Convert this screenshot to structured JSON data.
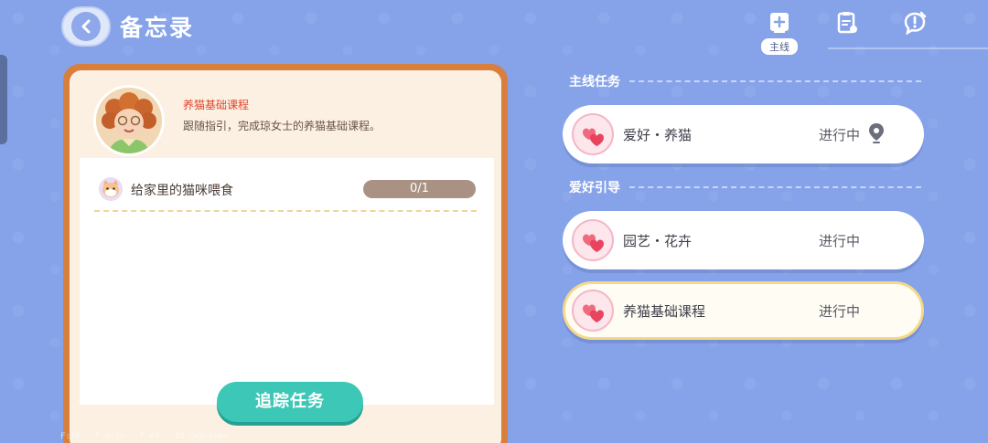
{
  "header": {
    "title": "备忘录",
    "mainline_tag": "主线"
  },
  "course": {
    "title": "养猫基础课程",
    "description": "跟随指引，完成琼女士的养猫基础课程。"
  },
  "task": {
    "label": "给家里的猫咪喂食",
    "progress": "0/1"
  },
  "track_button": "追踪任务",
  "debug_text": "F:58   T:0.50   F:60   ID:2m5rpumv",
  "sections": {
    "main": {
      "title": "主线任务",
      "quests": [
        {
          "name": "爱好・养猫",
          "status": "进行中"
        }
      ]
    },
    "hobby": {
      "title": "爱好引导",
      "quests": [
        {
          "name": "园艺・花卉",
          "status": "进行中"
        },
        {
          "name": "养猫基础课程",
          "status": "进行中"
        }
      ]
    }
  },
  "colors": {
    "background": "#86a3ea",
    "card_border": "#d97f3d",
    "track_button": "#3dc7b6",
    "course_title": "#e0462e",
    "selected_border": "#f5d88a"
  },
  "icons": [
    "back-arrow-icon",
    "add-task-icon",
    "clipboard-icon",
    "speech-alert-icon",
    "heart-bubble-icon",
    "location-pin-icon",
    "cat-face-icon"
  ]
}
